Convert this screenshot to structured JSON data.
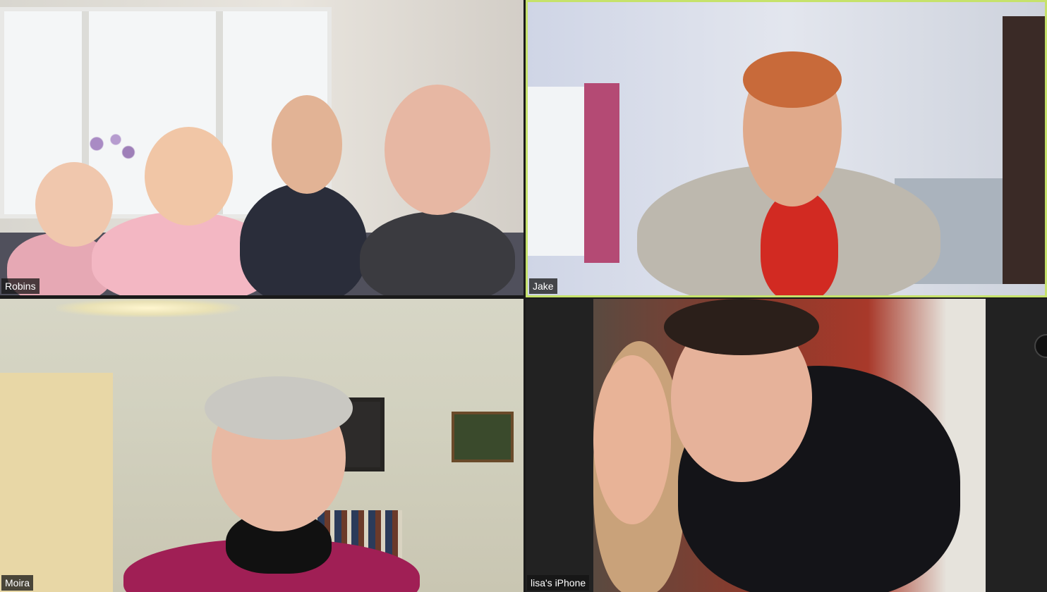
{
  "participants": [
    {
      "name": "Robins",
      "active": false
    },
    {
      "name": "Jake",
      "active": true
    },
    {
      "name": "Moira",
      "active": false
    },
    {
      "name": "lisa's iPhone",
      "active": false
    }
  ],
  "colors": {
    "active_speaker_border": "#c6e26b",
    "name_tag_bg": "#141414",
    "name_tag_text": "#ffffff",
    "background": "#1a1a1a"
  }
}
